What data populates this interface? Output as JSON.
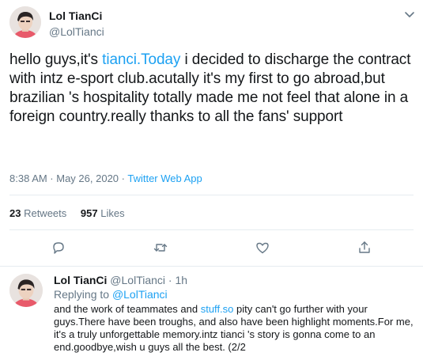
{
  "tweet": {
    "display_name": "Lol TianCi",
    "handle": "@LolTianci",
    "text_part1": "hello guys,it's ",
    "text_link": "tianci.Today",
    "text_part2": " i decided to discharge the contract with intz e-sport club.acutally it's my first to go abroad,but brazilian 's hospitality  totally made me not feel that alone in a foreign country.really thanks to all the fans' support",
    "timestamp": "8:38 AM · May 26, 2020 · ",
    "source_app": "Twitter Web App",
    "retweets_count": "23",
    "retweets_label": " Retweets",
    "likes_count": "957",
    "likes_label": " Likes"
  },
  "actions": [
    {
      "icon": "reply-icon"
    },
    {
      "icon": "retweet-icon"
    },
    {
      "icon": "like-icon"
    },
    {
      "icon": "share-icon"
    }
  ],
  "reply": {
    "display_name": "Lol TianCi",
    "meta": " @LolTianci · 1h",
    "replying_prefix": "Replying to ",
    "replying_handle": "@LolTianci",
    "text_part1": "and  the work of teammates and ",
    "text_link": "stuff.so",
    "text_part2": " pity can't go further with your guys.There have been troughs, and also have been highlight moments.For me, it's a truly unforgettable memory.intz tianci 's story is gonna come to an end.goodbye,wish u guys all the best.  (2/2"
  },
  "colors": {
    "link": "#1da1f2",
    "secondary_text": "#657786",
    "primary_text": "#14171a",
    "divider": "#e6ecf0"
  }
}
